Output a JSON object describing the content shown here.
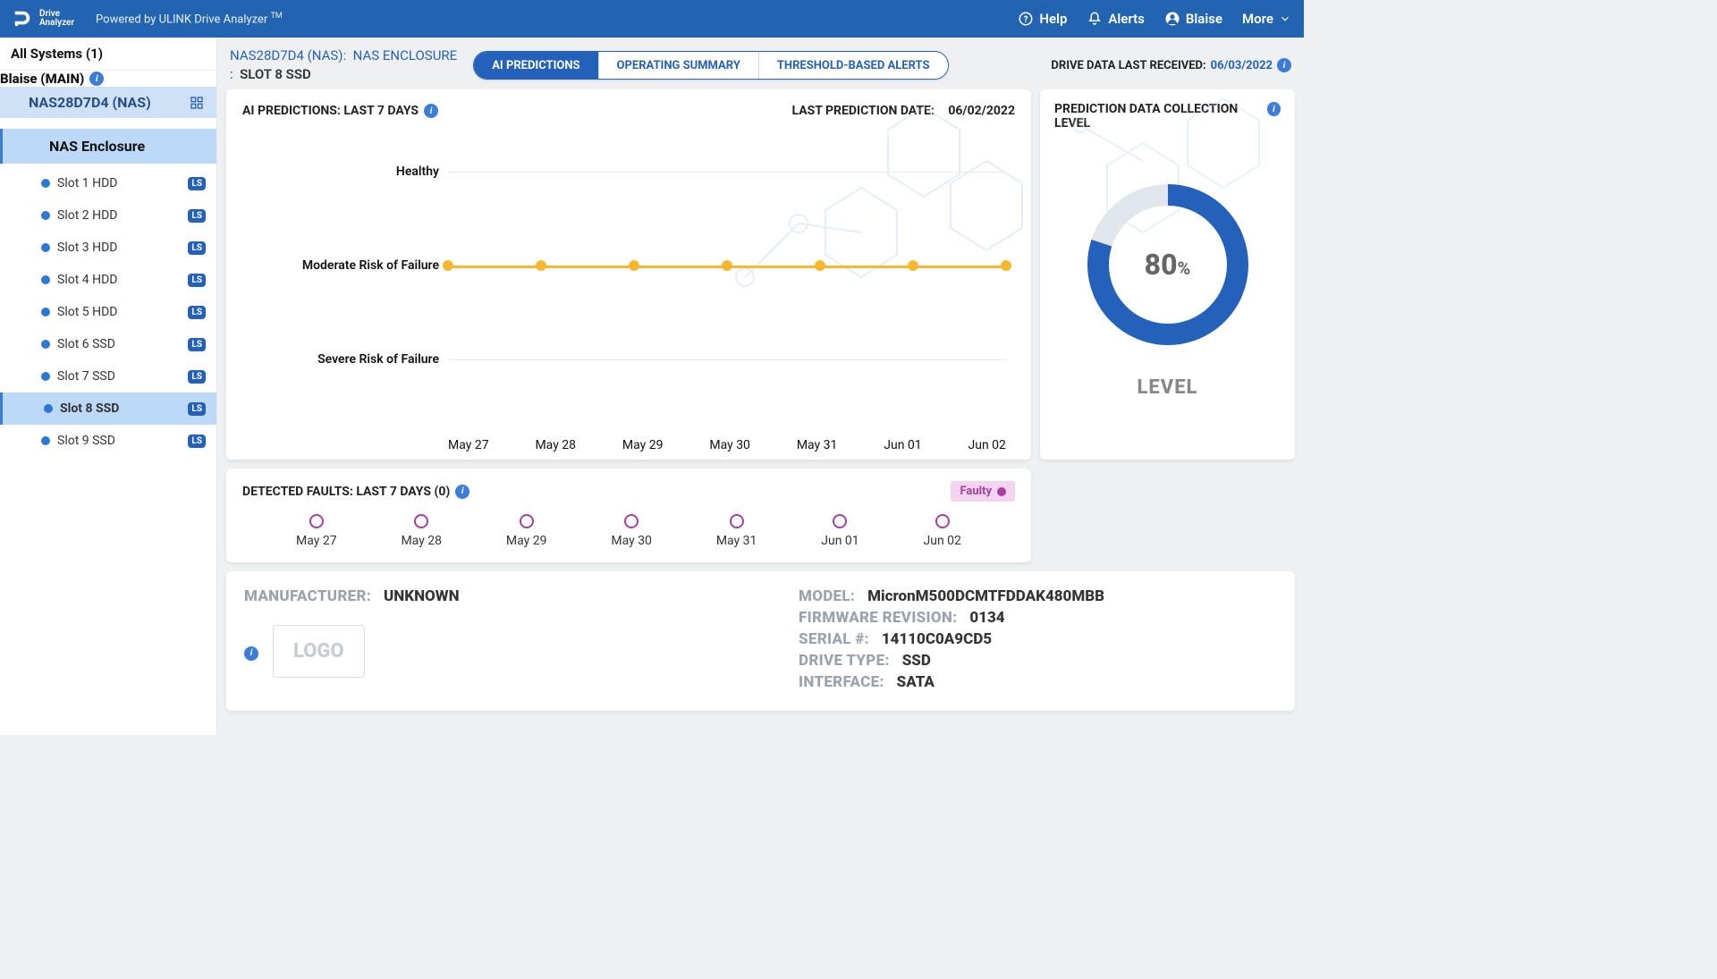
{
  "topbar": {
    "logo_line1": "Drive",
    "logo_line2": "Analyzer",
    "powered": "Powered by ULINK Drive Analyzer",
    "tm": "TM",
    "help": "Help",
    "alerts": "Alerts",
    "user": "Blaise",
    "more": "More"
  },
  "sidebar": {
    "all_systems": "All Systems (1)",
    "main": "Blaise (MAIN)",
    "nas": "NAS28D7D4 (NAS)",
    "enclosure": "NAS Enclosure",
    "slots": [
      {
        "label": "Slot 1 HDD",
        "active": false
      },
      {
        "label": "Slot 2 HDD",
        "active": false
      },
      {
        "label": "Slot 3 HDD",
        "active": false
      },
      {
        "label": "Slot 4 HDD",
        "active": false
      },
      {
        "label": "Slot 5 HDD",
        "active": false
      },
      {
        "label": "Slot 6 SSD",
        "active": false
      },
      {
        "label": "Slot 7 SSD",
        "active": false
      },
      {
        "label": "Slot 8 SSD",
        "active": true
      },
      {
        "label": "Slot 9 SSD",
        "active": false
      }
    ]
  },
  "breadcrumb": {
    "nas": "NAS28D7D4 (NAS):",
    "encl": "NAS ENCLOSURE",
    "sep": ":",
    "slot": "SLOT 8 SSD"
  },
  "tabs": {
    "ai": "AI PREDICTIONS",
    "op": "OPERATING SUMMARY",
    "th": "THRESHOLD-BASED ALERTS"
  },
  "last_received": {
    "label": "DRIVE DATA LAST RECEIVED:",
    "date": "06/03/2022"
  },
  "prediction": {
    "title": "AI PREDICTIONS: LAST 7 DAYS",
    "last_pred_label": "LAST PREDICTION DATE:",
    "last_pred_date": "06/02/2022"
  },
  "level": {
    "title": "PREDICTION DATA COLLECTION LEVEL",
    "pct_num": "80",
    "pct_sym": "%",
    "word": "LEVEL"
  },
  "faults": {
    "title": "DETECTED FAULTS: LAST 7 DAYS (0)",
    "faulty": "Faulty"
  },
  "specs": {
    "manufacturer_label": "MANUFACTURER:",
    "manufacturer": "UNKNOWN",
    "logo": "LOGO",
    "model_label": "MODEL:",
    "model": "MicronM500DCMTFDDAK480MBB",
    "fw_label": "FIRMWARE REVISION:",
    "fw": "0134",
    "serial_label": "SERIAL #:",
    "serial": "14110C0A9CD5",
    "type_label": "DRIVE TYPE:",
    "type": "SSD",
    "iface_label": "INTERFACE:",
    "iface": "SATA"
  },
  "chart_data": {
    "type": "line",
    "categories": [
      "May 27",
      "May 28",
      "May 29",
      "May 30",
      "May 31",
      "Jun 01",
      "Jun 02"
    ],
    "y_levels": [
      "Healthy",
      "Moderate Risk of Failure",
      "Severe Risk of Failure"
    ],
    "series": [
      {
        "name": "AI Prediction",
        "values_level": [
          "Moderate Risk of Failure",
          "Moderate Risk of Failure",
          "Moderate Risk of Failure",
          "Moderate Risk of Failure",
          "Moderate Risk of Failure",
          "Moderate Risk of Failure",
          "Moderate Risk of Failure"
        ],
        "color": "#f6b731"
      }
    ],
    "faults_series": {
      "categories": [
        "May 27",
        "May 28",
        "May 29",
        "May 30",
        "May 31",
        "Jun 01",
        "Jun 02"
      ],
      "faulty": [
        false,
        false,
        false,
        false,
        false,
        false,
        false
      ]
    },
    "collection_level_pct": 80
  }
}
